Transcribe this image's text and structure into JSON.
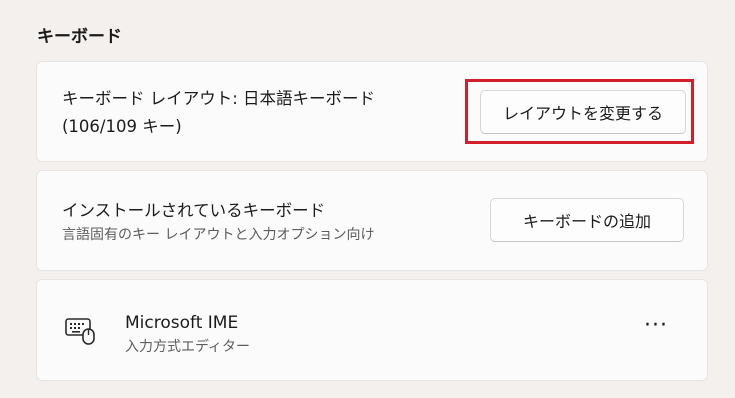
{
  "section": {
    "title": "キーボード"
  },
  "layout_card": {
    "title": "キーボード レイアウト: 日本語キーボード",
    "subtitle": "(106/109 キー)",
    "button_label": "レイアウトを変更する"
  },
  "install_card": {
    "title": "インストールされているキーボード",
    "subtitle": "言語固有のキー レイアウトと入力オプション向け",
    "button_label": "キーボードの追加"
  },
  "ime_card": {
    "name": "Microsoft IME",
    "description": "入力方式エディター",
    "icon": "keyboard-mouse-icon",
    "more_label": "···"
  },
  "colors": {
    "highlight": "#d11f2c",
    "background": "#f3f0ed",
    "card": "#fbfbfb"
  }
}
